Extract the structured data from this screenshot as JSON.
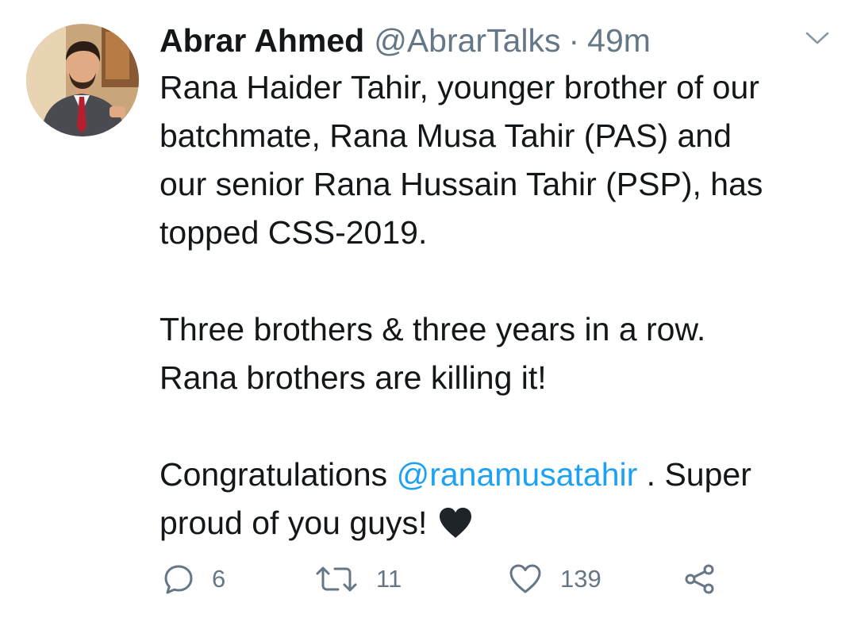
{
  "tweet": {
    "author": {
      "name": "Abrar Ahmed",
      "handle": "@AbrarTalks",
      "avatar_description": "profile-photo"
    },
    "separator": "·",
    "time": "49m",
    "menu_icon": "chevron-down-icon",
    "lines": [
      "Rana Haider Tahir, younger brother of our",
      "batchmate, Rana Musa Tahir (PAS) and",
      "our senior Rana Hussain Tahir (PSP), has",
      "topped CSS-2019.",
      "",
      "Three brothers & three years in a row.",
      "Rana brothers are killing it!",
      "",
      "proud of you guys!"
    ],
    "congrats": {
      "before": "Congratulations ",
      "mention": "@ranamusatahir",
      "after": " . Super"
    },
    "emoji": "black-heart",
    "actions": {
      "reply": {
        "icon": "reply-icon",
        "count": "6"
      },
      "retweet": {
        "icon": "retweet-icon",
        "count": "11"
      },
      "like": {
        "icon": "heart-icon",
        "count": "139"
      },
      "share": {
        "icon": "share-icon"
      }
    },
    "colors": {
      "text": "#14171a",
      "secondary": "#657786",
      "link": "#1da1f2",
      "background": "#ffffff"
    }
  }
}
